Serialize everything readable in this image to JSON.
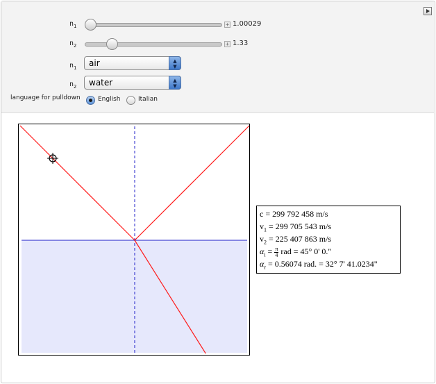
{
  "controls": {
    "n1_slider": {
      "label": "n",
      "sub": "1",
      "value_text": "1.00029",
      "position": 0.0
    },
    "n2_slider": {
      "label": "n",
      "sub": "2",
      "value_text": "1.33",
      "position": 0.17
    },
    "n1_select": {
      "label": "n",
      "sub": "1",
      "selected": "air"
    },
    "n2_select": {
      "label": "n",
      "sub": "2",
      "selected": "water"
    },
    "language": {
      "label": "language for pulldown",
      "options": [
        "English",
        "Italian"
      ],
      "selected": "English"
    }
  },
  "plot": {
    "bg_color": "#ffffff",
    "medium2_color": "#e6e8fc",
    "ray_color": "#ff1a1a",
    "interface_color": "#2020c8",
    "normal_color": "#2020c8",
    "incidence_angle_deg": 45,
    "refraction_angle_deg": 32.1
  },
  "info": {
    "c": {
      "sym": "c",
      "text": "= 299 792 458 m/s"
    },
    "v1": {
      "sym": "v",
      "sub": "1",
      "text": "= 299 705 543 m/s"
    },
    "v2": {
      "sym": "v",
      "sub": "2",
      "text": "= 225 407 863 m/s"
    },
    "alpha_i": {
      "sym": "α",
      "sub": "i",
      "eq": "=",
      "num": "π",
      "den": "4",
      "text": "rad = 45° 0' 0.\""
    },
    "alpha_r": {
      "sym": "α",
      "sub": "r",
      "text": "= 0.56074 rad. = 32° 7' 41.0234\""
    }
  }
}
